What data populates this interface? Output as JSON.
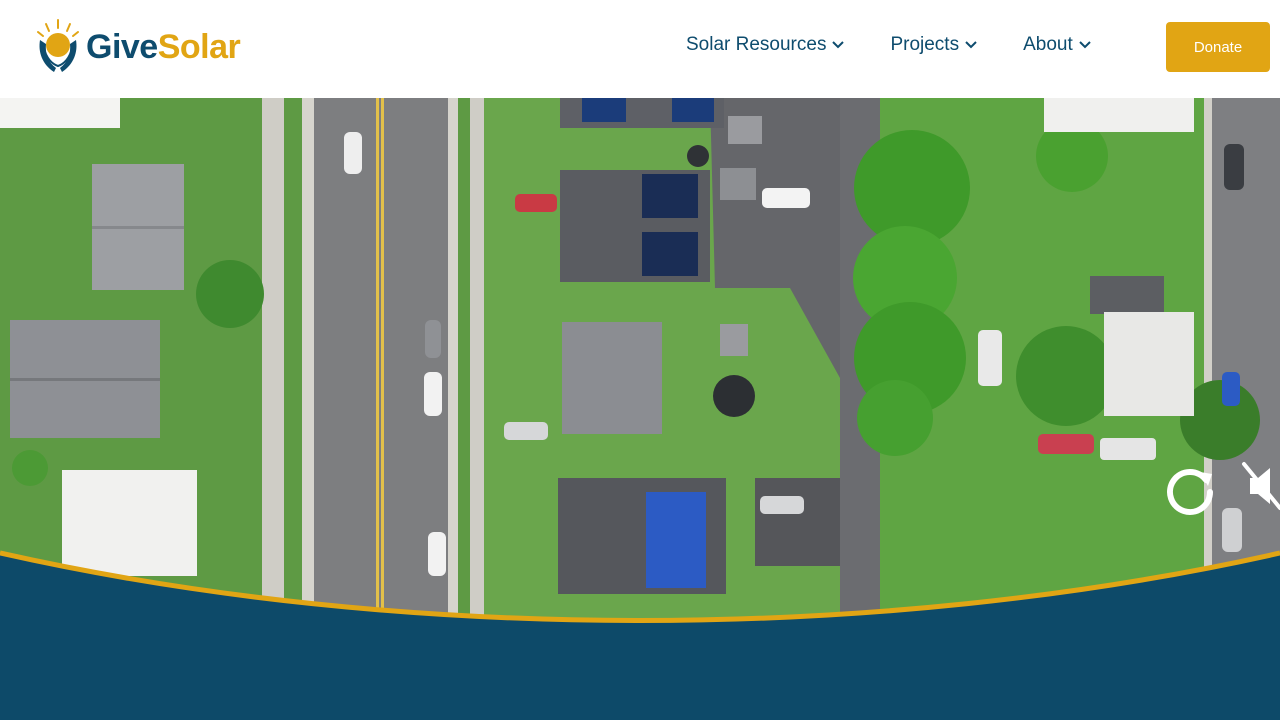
{
  "brand": {
    "name_part1": "Give",
    "name_part2": "Solar",
    "logo_icon": "sun-hands-icon",
    "colors": {
      "navy": "#0e4c6e",
      "gold": "#e1a514",
      "band": "#0b4a6a"
    }
  },
  "nav": {
    "items": [
      {
        "label": "Solar Resources",
        "icon": "chevron-down-icon"
      },
      {
        "label": "Projects",
        "icon": "chevron-down-icon"
      },
      {
        "label": "About",
        "icon": "chevron-down-icon"
      }
    ],
    "donate_label": "Donate"
  },
  "hero": {
    "media": "aerial video of a residential street with rooftop solar panels",
    "controls": {
      "replay_icon": "replay-icon",
      "mute_icon": "muted-speaker-icon"
    }
  }
}
